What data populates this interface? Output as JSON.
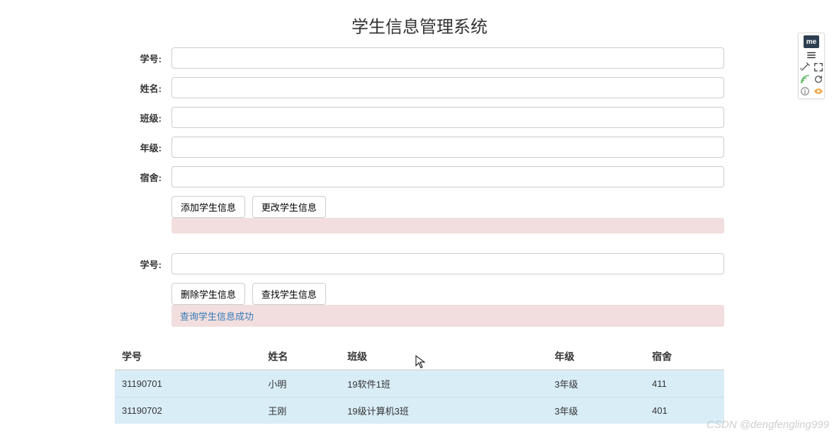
{
  "title": "学生信息管理系统",
  "form1": {
    "labels": {
      "id": "学号:",
      "name": "姓名:",
      "class": "班级:",
      "grade": "年级:",
      "dorm": "宿舍:"
    },
    "values": {
      "id": "",
      "name": "",
      "class": "",
      "grade": "",
      "dorm": ""
    },
    "add_btn": "添加学生信息",
    "update_btn": "更改学生信息",
    "status": ""
  },
  "form2": {
    "labels": {
      "id": "学号:"
    },
    "values": {
      "id": ""
    },
    "delete_btn": "删除学生信息",
    "search_btn": "查找学生信息",
    "status": "查询学生信息成功"
  },
  "table": {
    "headers": [
      "学号",
      "姓名",
      "班级",
      "年级",
      "宿舍"
    ],
    "rows": [
      {
        "id": "31190701",
        "name": "小明",
        "class": "19软件1班",
        "grade": "3年级",
        "dorm": "411"
      },
      {
        "id": "31190702",
        "name": "王刚",
        "class": "19级计算机3班",
        "grade": "3年级",
        "dorm": "401"
      }
    ]
  },
  "watermark": "CSDN @dengfengling999",
  "side": {
    "me": "me"
  }
}
